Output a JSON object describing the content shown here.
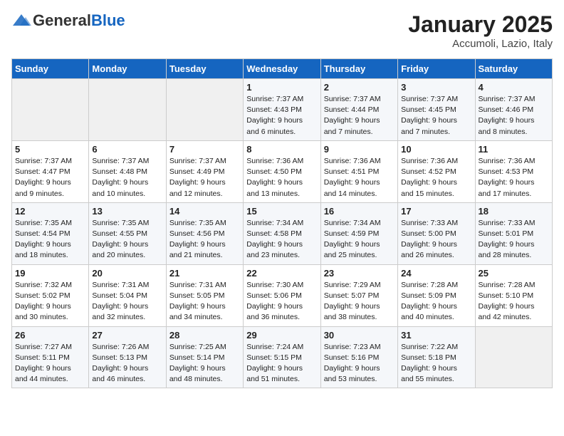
{
  "header": {
    "logo_general": "General",
    "logo_blue": "Blue",
    "month_title": "January 2025",
    "location": "Accumoli, Lazio, Italy"
  },
  "days_of_week": [
    "Sunday",
    "Monday",
    "Tuesday",
    "Wednesday",
    "Thursday",
    "Friday",
    "Saturday"
  ],
  "weeks": [
    [
      {
        "day": "",
        "detail": ""
      },
      {
        "day": "",
        "detail": ""
      },
      {
        "day": "",
        "detail": ""
      },
      {
        "day": "1",
        "detail": "Sunrise: 7:37 AM\nSunset: 4:43 PM\nDaylight: 9 hours\nand 6 minutes."
      },
      {
        "day": "2",
        "detail": "Sunrise: 7:37 AM\nSunset: 4:44 PM\nDaylight: 9 hours\nand 7 minutes."
      },
      {
        "day": "3",
        "detail": "Sunrise: 7:37 AM\nSunset: 4:45 PM\nDaylight: 9 hours\nand 7 minutes."
      },
      {
        "day": "4",
        "detail": "Sunrise: 7:37 AM\nSunset: 4:46 PM\nDaylight: 9 hours\nand 8 minutes."
      }
    ],
    [
      {
        "day": "5",
        "detail": "Sunrise: 7:37 AM\nSunset: 4:47 PM\nDaylight: 9 hours\nand 9 minutes."
      },
      {
        "day": "6",
        "detail": "Sunrise: 7:37 AM\nSunset: 4:48 PM\nDaylight: 9 hours\nand 10 minutes."
      },
      {
        "day": "7",
        "detail": "Sunrise: 7:37 AM\nSunset: 4:49 PM\nDaylight: 9 hours\nand 12 minutes."
      },
      {
        "day": "8",
        "detail": "Sunrise: 7:36 AM\nSunset: 4:50 PM\nDaylight: 9 hours\nand 13 minutes."
      },
      {
        "day": "9",
        "detail": "Sunrise: 7:36 AM\nSunset: 4:51 PM\nDaylight: 9 hours\nand 14 minutes."
      },
      {
        "day": "10",
        "detail": "Sunrise: 7:36 AM\nSunset: 4:52 PM\nDaylight: 9 hours\nand 15 minutes."
      },
      {
        "day": "11",
        "detail": "Sunrise: 7:36 AM\nSunset: 4:53 PM\nDaylight: 9 hours\nand 17 minutes."
      }
    ],
    [
      {
        "day": "12",
        "detail": "Sunrise: 7:35 AM\nSunset: 4:54 PM\nDaylight: 9 hours\nand 18 minutes."
      },
      {
        "day": "13",
        "detail": "Sunrise: 7:35 AM\nSunset: 4:55 PM\nDaylight: 9 hours\nand 20 minutes."
      },
      {
        "day": "14",
        "detail": "Sunrise: 7:35 AM\nSunset: 4:56 PM\nDaylight: 9 hours\nand 21 minutes."
      },
      {
        "day": "15",
        "detail": "Sunrise: 7:34 AM\nSunset: 4:58 PM\nDaylight: 9 hours\nand 23 minutes."
      },
      {
        "day": "16",
        "detail": "Sunrise: 7:34 AM\nSunset: 4:59 PM\nDaylight: 9 hours\nand 25 minutes."
      },
      {
        "day": "17",
        "detail": "Sunrise: 7:33 AM\nSunset: 5:00 PM\nDaylight: 9 hours\nand 26 minutes."
      },
      {
        "day": "18",
        "detail": "Sunrise: 7:33 AM\nSunset: 5:01 PM\nDaylight: 9 hours\nand 28 minutes."
      }
    ],
    [
      {
        "day": "19",
        "detail": "Sunrise: 7:32 AM\nSunset: 5:02 PM\nDaylight: 9 hours\nand 30 minutes."
      },
      {
        "day": "20",
        "detail": "Sunrise: 7:31 AM\nSunset: 5:04 PM\nDaylight: 9 hours\nand 32 minutes."
      },
      {
        "day": "21",
        "detail": "Sunrise: 7:31 AM\nSunset: 5:05 PM\nDaylight: 9 hours\nand 34 minutes."
      },
      {
        "day": "22",
        "detail": "Sunrise: 7:30 AM\nSunset: 5:06 PM\nDaylight: 9 hours\nand 36 minutes."
      },
      {
        "day": "23",
        "detail": "Sunrise: 7:29 AM\nSunset: 5:07 PM\nDaylight: 9 hours\nand 38 minutes."
      },
      {
        "day": "24",
        "detail": "Sunrise: 7:28 AM\nSunset: 5:09 PM\nDaylight: 9 hours\nand 40 minutes."
      },
      {
        "day": "25",
        "detail": "Sunrise: 7:28 AM\nSunset: 5:10 PM\nDaylight: 9 hours\nand 42 minutes."
      }
    ],
    [
      {
        "day": "26",
        "detail": "Sunrise: 7:27 AM\nSunset: 5:11 PM\nDaylight: 9 hours\nand 44 minutes."
      },
      {
        "day": "27",
        "detail": "Sunrise: 7:26 AM\nSunset: 5:13 PM\nDaylight: 9 hours\nand 46 minutes."
      },
      {
        "day": "28",
        "detail": "Sunrise: 7:25 AM\nSunset: 5:14 PM\nDaylight: 9 hours\nand 48 minutes."
      },
      {
        "day": "29",
        "detail": "Sunrise: 7:24 AM\nSunset: 5:15 PM\nDaylight: 9 hours\nand 51 minutes."
      },
      {
        "day": "30",
        "detail": "Sunrise: 7:23 AM\nSunset: 5:16 PM\nDaylight: 9 hours\nand 53 minutes."
      },
      {
        "day": "31",
        "detail": "Sunrise: 7:22 AM\nSunset: 5:18 PM\nDaylight: 9 hours\nand 55 minutes."
      },
      {
        "day": "",
        "detail": ""
      }
    ]
  ]
}
